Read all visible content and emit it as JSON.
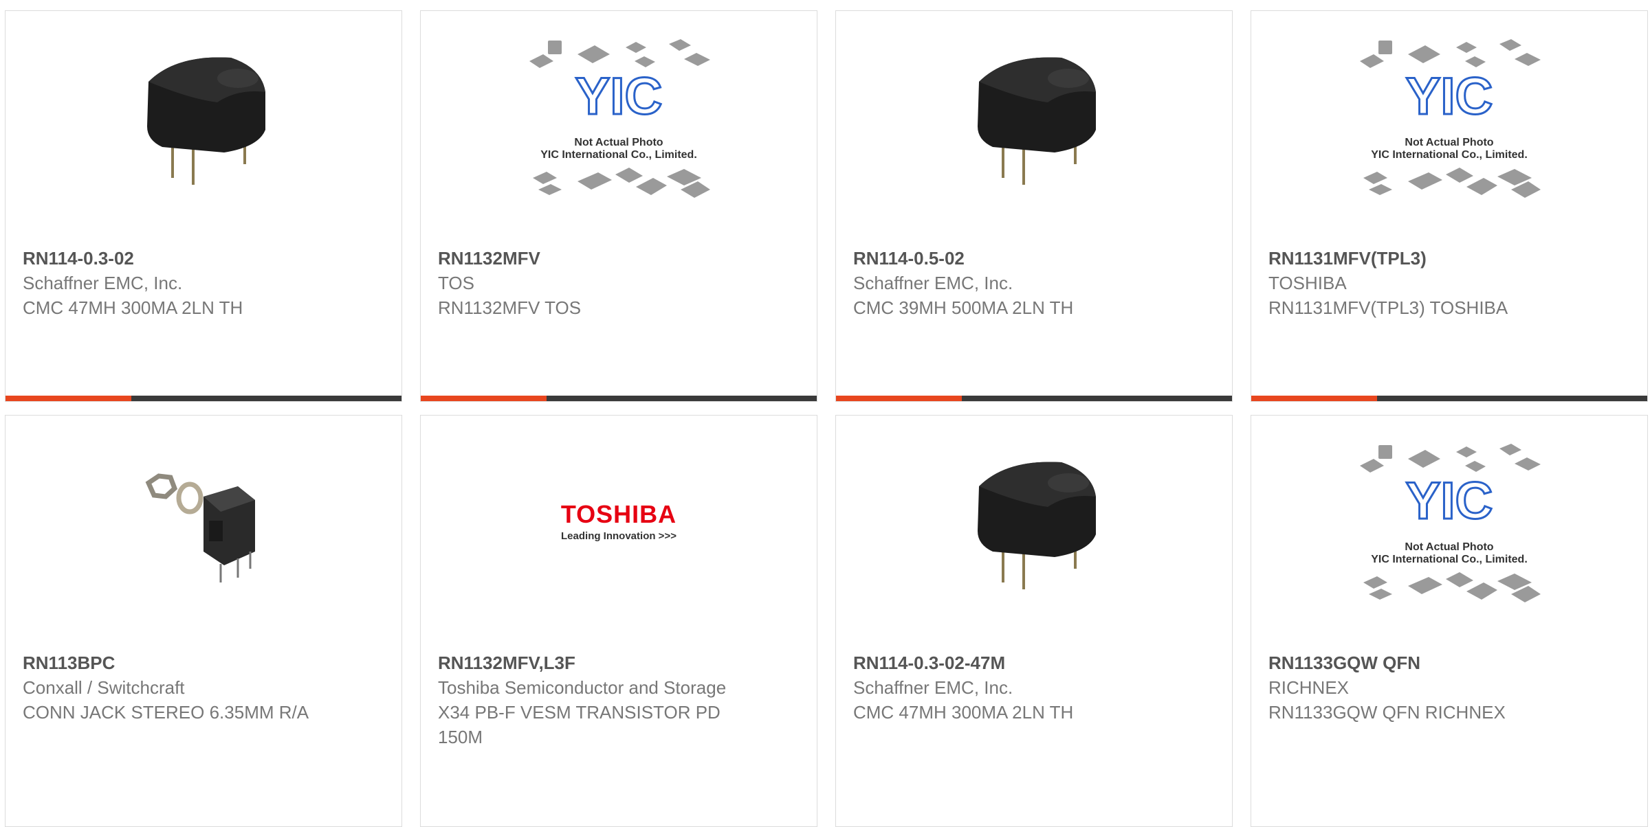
{
  "products": [
    {
      "part_number": "RN114-0.3-02",
      "manufacturer": "Schaffner EMC, Inc.",
      "description": "CMC 47MH 300MA 2LN TH",
      "image": "choke-coil-icon"
    },
    {
      "part_number": "RN1132MFV",
      "manufacturer": "TOS",
      "description": "RN1132MFV TOS",
      "image": "placeholder-not-actual-photo"
    },
    {
      "part_number": "RN114-0.5-02",
      "manufacturer": "Schaffner EMC, Inc.",
      "description": "CMC 39MH 500MA 2LN TH",
      "image": "choke-coil-icon"
    },
    {
      "part_number": "RN1131MFV(TPL3)",
      "manufacturer": "TOSHIBA",
      "description": "RN1131MFV(TPL3) TOSHIBA",
      "image": "placeholder-not-actual-photo"
    },
    {
      "part_number": "RN113BPC",
      "manufacturer": "Conxall / Switchcraft",
      "description": "CONN JACK STEREO 6.35MM R/A",
      "image": "audio-jack-icon"
    },
    {
      "part_number": "RN1132MFV,L3F",
      "manufacturer": "Toshiba Semiconductor and Storage",
      "description": "X34 PB-F VESM TRANSISTOR PD 150M",
      "image": "toshiba-logo"
    },
    {
      "part_number": "RN114-0.3-02-47M",
      "manufacturer": "Schaffner EMC, Inc.",
      "description": "CMC 47MH 300MA 2LN TH",
      "image": "choke-coil-icon"
    },
    {
      "part_number": "RN1133GQW QFN",
      "manufacturer": "RICHNEX",
      "description": "RN1133GQW QFN RICHNEX",
      "image": "placeholder-not-actual-photo"
    }
  ],
  "placeholder": {
    "logo_text": "YIC",
    "line1": "Not Actual Photo",
    "line2": "YIC International Co., Limited."
  },
  "toshiba": {
    "brand": "TOSHIBA",
    "tagline": "Leading Innovation >>>"
  },
  "colors": {
    "accent": "#e8461e",
    "bar": "#3a3a3a",
    "border": "#dcdcdc"
  }
}
